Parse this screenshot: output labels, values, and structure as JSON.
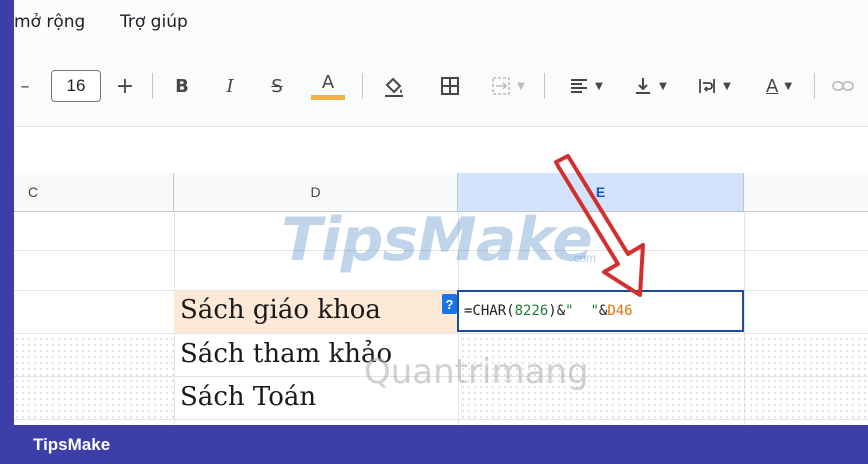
{
  "menu": {
    "items": [
      "mở rộng",
      "Trợ giúp"
    ]
  },
  "toolbar": {
    "decrease_label": "–",
    "font_size": "16",
    "increase_label": "+",
    "bold_label": "B",
    "italic_label": "I",
    "strike_label": "S",
    "text_color_label": "A",
    "text_color_accent": "#f6b142",
    "text_color2_label": "A"
  },
  "grid": {
    "columns": [
      "C",
      "D",
      "E"
    ],
    "cells": {
      "d46": "Sách giáo khoa",
      "d47": "Sách tham khảo",
      "d48": "Sách Toán"
    },
    "editor": {
      "formula_prefix": "=CHAR(",
      "formula_number": "8226",
      "formula_mid": ")&",
      "formula_string": "\"  \"",
      "formula_amp": "&",
      "formula_ref": "D46"
    },
    "help_badge": "?"
  },
  "watermarks": {
    "brand": "TipsMake",
    "brand_suffix": ".com",
    "qtm": "Quantrimang"
  },
  "footer": {
    "label": "TipsMake"
  },
  "colors": {
    "selection_highlight": "#fce9d6",
    "editor_border": "#1a4e93",
    "arrow": "#d32f2f",
    "footer_bg": "#3c3fa8"
  }
}
